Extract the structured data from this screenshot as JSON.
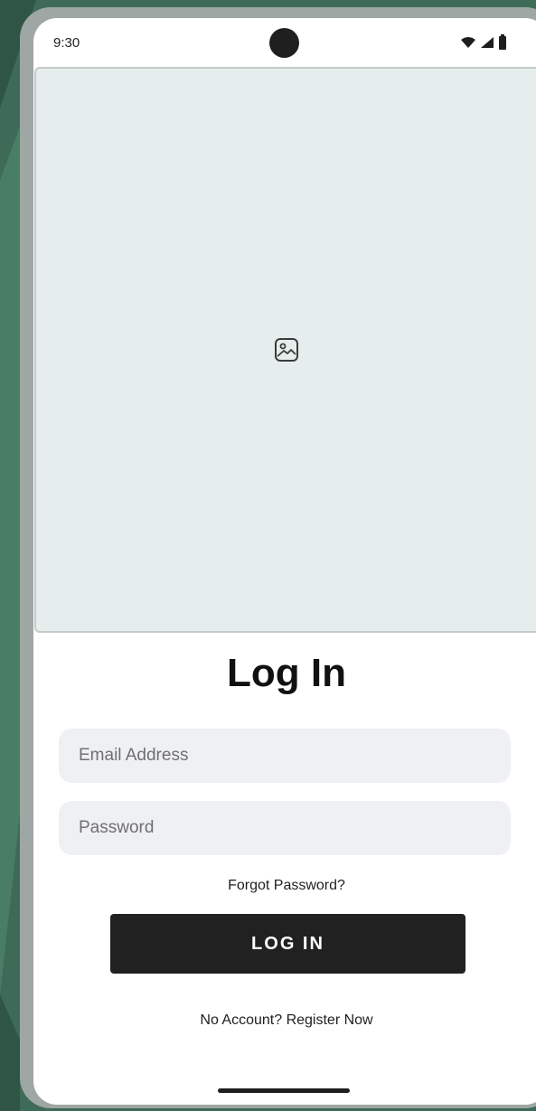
{
  "status_bar": {
    "time": "9:30",
    "icons": [
      "wifi-icon",
      "signal-icon",
      "battery-icon"
    ]
  },
  "hero": {
    "icon": "image-placeholder-icon"
  },
  "login": {
    "title": "Log In",
    "email_placeholder": "Email Address",
    "password_placeholder": "Password",
    "forgot_label": "Forgot Password?",
    "button_label": "LOG IN",
    "register_label": "No Account? Register Now"
  },
  "colors": {
    "background": "#3e6b57",
    "button": "#212121",
    "field": "#eff0f4",
    "image_placeholder": "#e5eeec"
  }
}
